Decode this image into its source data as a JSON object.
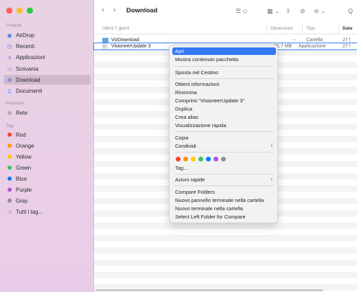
{
  "sidebar": {
    "favorites_title": "Preferiti",
    "favorites": [
      {
        "label": "AirDrop",
        "icon": "airdrop-icon"
      },
      {
        "label": "Recenti",
        "icon": "clock-icon"
      },
      {
        "label": "Applicazioni",
        "icon": "apps-icon"
      },
      {
        "label": "Scrivania",
        "icon": "desktop-icon"
      },
      {
        "label": "Download",
        "icon": "download-icon",
        "selected": true
      },
      {
        "label": "Documenti",
        "icon": "document-icon"
      }
    ],
    "locations_title": "Posizioni",
    "locations": [
      {
        "label": "Rete",
        "icon": "network-icon"
      }
    ],
    "tags_title": "Tag",
    "tags": [
      {
        "label": "Red",
        "color": "#ff3b30"
      },
      {
        "label": "Orange",
        "color": "#ff9500"
      },
      {
        "label": "Yellow",
        "color": "#ffcc00"
      },
      {
        "label": "Green",
        "color": "#34c759"
      },
      {
        "label": "Blue",
        "color": "#007aff"
      },
      {
        "label": "Purple",
        "color": "#af52de"
      },
      {
        "label": "Gray",
        "color": "#8e8e93"
      }
    ],
    "all_tags": "Tutti i tag..."
  },
  "toolbar": {
    "back": "‹",
    "forward": "›",
    "title": "Download",
    "view_icon": "☰ ◇",
    "group_icon": "▦ ⌄",
    "share_icon": "⇪",
    "tag_icon": "⊘",
    "more_icon": "⊖ ⌄",
    "search_icon": "Q"
  },
  "columns": {
    "name": "Ultimi 7 giorni",
    "size": "Dimensioni",
    "kind": "Tipo",
    "date": "Data"
  },
  "files": [
    {
      "name": "VizDownload",
      "size": "--",
      "kind": "Cartella",
      "date": "27 l"
    },
    {
      "name": "VisioneerUpdate 3",
      "size": "35,7 MB",
      "kind": "Applicazione",
      "date": "27 l"
    }
  ],
  "context_menu": {
    "open": "Apri",
    "show_package": "Mostra contenuto pacchetto",
    "trash": "Sposta nel Cestino",
    "info": "Ottieni informazioni",
    "rename": "Rinomina",
    "compress": "Comprimi \"VisioneerUpdate 3\"",
    "duplicate": "Duplica",
    "alias": "Crea alias",
    "quicklook": "Visualizzazione rapida",
    "copy": "Copia",
    "share": "Condividi",
    "tag": "Tag...",
    "quick_actions": "Azioni rapide",
    "compare": "Compare Folders",
    "new_terminal_tab": "Nuovo pannello terminale nella cartella",
    "new_terminal": "Nuovo terminale nella cartella",
    "select_left": "Select Left Folder for Compare",
    "submenu_arrow": "›",
    "tag_colors": [
      "#ff3b30",
      "#ff9500",
      "#ffcc00",
      "#34c759",
      "#007aff",
      "#af52de",
      "#8e8e93"
    ]
  }
}
